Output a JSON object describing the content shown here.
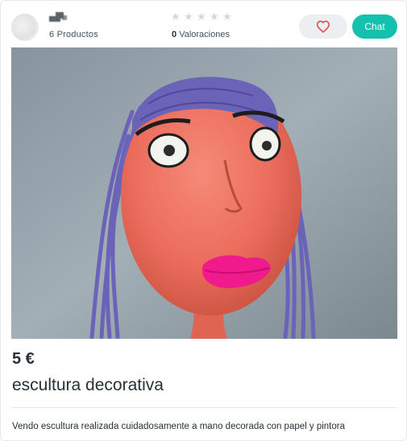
{
  "seller": {
    "products_label": "6 Productos"
  },
  "rating": {
    "count": "0",
    "label": "Valoraciones",
    "stars": 0
  },
  "actions": {
    "chat_label": "Chat",
    "favorite_icon": "heart-icon"
  },
  "item": {
    "price": "5 €",
    "title": "escultura decorativa",
    "description": "Vendo escultura realizada cuidadosamente a mano decorada con papel y pintora"
  },
  "colors": {
    "accent": "#13c1ac",
    "heart": "#e5484d",
    "text": "#253238"
  }
}
